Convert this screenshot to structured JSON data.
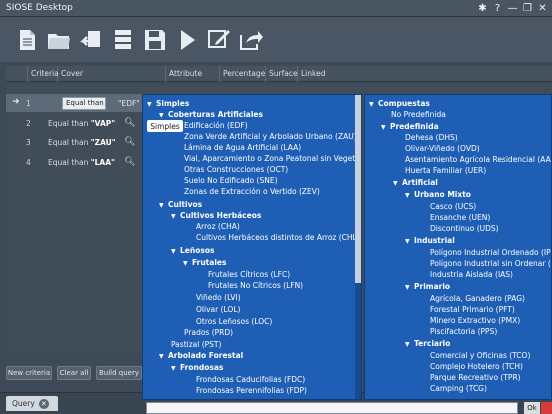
{
  "window": {
    "title": "SIOSE Desktop"
  },
  "window_controls": [
    {
      "name": "settings-icon",
      "glyph": "✱"
    },
    {
      "name": "help-icon",
      "glyph": "?"
    },
    {
      "name": "minimize-icon",
      "glyph": "—"
    },
    {
      "name": "restore-icon",
      "glyph": "❐"
    },
    {
      "name": "close-icon",
      "glyph": "✕"
    }
  ],
  "toolbar": {
    "icons": [
      "new-document-icon",
      "open-folder-icon",
      "undo-icon",
      "database-icon",
      "save-icon",
      "run-icon",
      "edit-icon",
      "export-icon"
    ]
  },
  "table": {
    "headers": [
      "Criteria",
      "Cover",
      "Attribute",
      "Percentage",
      "Surface",
      "Linked"
    ],
    "rows": [
      {
        "num": "1",
        "combo": "Equal than",
        "value": "\"EDF\""
      },
      {
        "num": "2",
        "prefix": "Equal than ",
        "value": "\"VAP\""
      },
      {
        "num": "3",
        "prefix": "Equal than ",
        "value": "\"ZAU\""
      },
      {
        "num": "4",
        "prefix": "Equal than ",
        "value": "\"LAA\""
      }
    ]
  },
  "popup": {
    "simples_button": "Simples",
    "left_tree": [
      "Simples",
      "Coberturas Artificiales",
      "Edificación (EDF)",
      "Zona Verde Artificial y Arbolado Urbano (ZAU)",
      "Lámina de Agua Artificial (LAA)",
      "Vial, Aparcamiento o Zona Peatonal sin Vegetación",
      "Otras Construcciones (OCT)",
      "Suelo No Edificado (SNE)",
      "Zonas de Extracción o Vertido (ZEV)",
      "Cultivos",
      "Cultivos Herbáceos",
      "Arroz (CHA)",
      "Cultivos Herbáceos distintos de Arroz (CHL)",
      "Leñosos",
      "Frutales",
      "Frutales Cítricos (LFC)",
      "Frutales No Cítricos (LFN)",
      "Viñedo (LVI)",
      "Olivar (LOL)",
      "Otros Leñosos (LOC)",
      "Prados (PRD)",
      "Pastizal (PST)",
      "Arbolado Forestal",
      "Frondosas",
      "Frondosas Caducifolias (FDC)",
      "Frondosas Perennifolias (FDP)"
    ],
    "right_tree": [
      "Compuestas",
      "No Predefinida",
      "Predefinida",
      "Dehesa (DHS)",
      "Olivar-Viñedo (OVD)",
      "Asentamiento Agrícola Residencial (AAR)",
      "Huerta Familiar (UER)",
      "Artificial",
      "Urbano Mixto",
      "Casco (UCS)",
      "Ensanche (UEN)",
      "Discontinuo (UDS)",
      "Industrial",
      "Polígono Industrial Ordenado (IPO)",
      "Polígono Industrial sin Ordenar (IPS)",
      "Industria Aislada (IAS)",
      "Primario",
      "Agrícola, Ganadero (PAG)",
      "Forestal Primario (PFT)",
      "Minero Extractivo (PMX)",
      "Piscifactoria (PPS)",
      "Terciario",
      "Comercial y Oficinas (TCO)",
      "Complejo Hotelero (TCH)",
      "Parque Recreativo (TPR)",
      "Camping (TCG)"
    ]
  },
  "buttons": {
    "new_criteria": "New criteria",
    "clear_all": "Clear all",
    "build_query": "Build query",
    "ok": "Ok"
  },
  "tab": {
    "query": "Query"
  },
  "colors": {
    "popup_bg": "#1e5fb5",
    "app_bg": "#3e4a58"
  }
}
